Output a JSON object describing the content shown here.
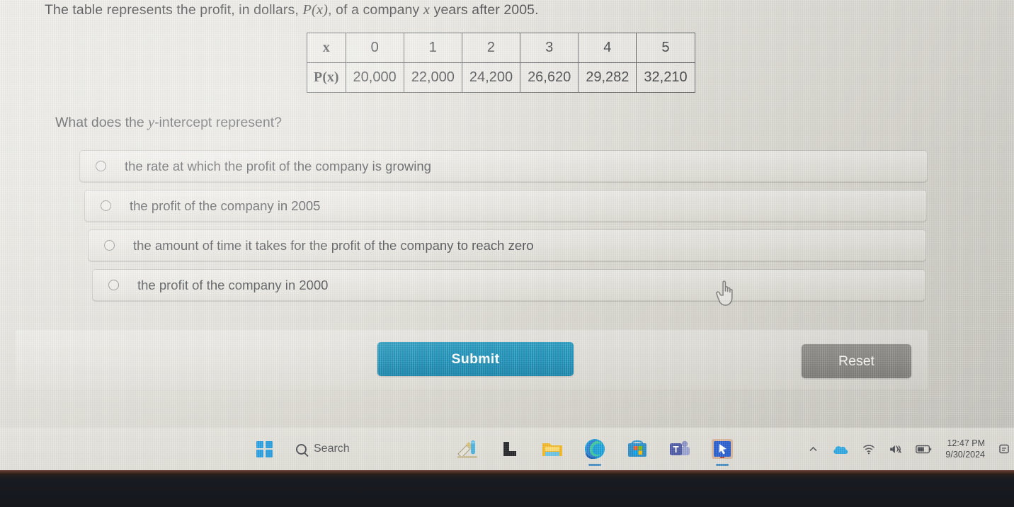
{
  "prompt": {
    "before": "The table represents the profit, in dollars, ",
    "math1": "P(x)",
    "middle": ", of a company ",
    "math2": "x",
    "after": " years after 2005."
  },
  "table": {
    "row_labels": [
      "x",
      "P(x)"
    ],
    "x_values": [
      "0",
      "1",
      "2",
      "3",
      "4",
      "5"
    ],
    "p_values": [
      "20,000",
      "22,000",
      "24,200",
      "26,620",
      "29,282",
      "32,210"
    ]
  },
  "question": {
    "before": "What does the ",
    "math": "y",
    "after": "-intercept represent?"
  },
  "options": [
    {
      "label": "the rate at which the profit of the company is growing",
      "selected": false
    },
    {
      "label": "the profit of the company in 2005",
      "selected": false
    },
    {
      "label": "the amount of time it takes for the profit of the company to reach zero",
      "selected": false
    },
    {
      "label": "the profit of the company in 2000",
      "selected": false
    }
  ],
  "actions": {
    "submit_label": "Submit",
    "reset_label": "Reset",
    "submit_color": "#2191b8",
    "reset_color": "#85847f"
  },
  "cursor": {
    "type": "pointer-hand-cursor"
  },
  "taskbar": {
    "start_icon": "windows-logo-icon",
    "search": {
      "placeholder": "Search",
      "value": "",
      "icon": "search-icon"
    },
    "apps": [
      {
        "name": "paint-icon",
        "active": false
      },
      {
        "name": "dark-app-icon",
        "active": false
      },
      {
        "name": "file-explorer-icon",
        "active": false
      },
      {
        "name": "microsoft-edge-icon",
        "active": true
      },
      {
        "name": "microsoft-store-icon",
        "active": false
      },
      {
        "name": "microsoft-teams-icon",
        "active": false
      },
      {
        "name": "remote-desktop-icon",
        "active": true
      }
    ],
    "tray": {
      "overflow_icon": "chevron-up-icon",
      "onedrive_icon": "cloud-icon",
      "wifi_icon": "wifi-icon",
      "volume_icon": "speaker-muted-icon",
      "battery_icon": "battery-icon",
      "time": "12:47 PM",
      "date": "9/30/2024",
      "notification_icon": "notification-icon"
    }
  }
}
